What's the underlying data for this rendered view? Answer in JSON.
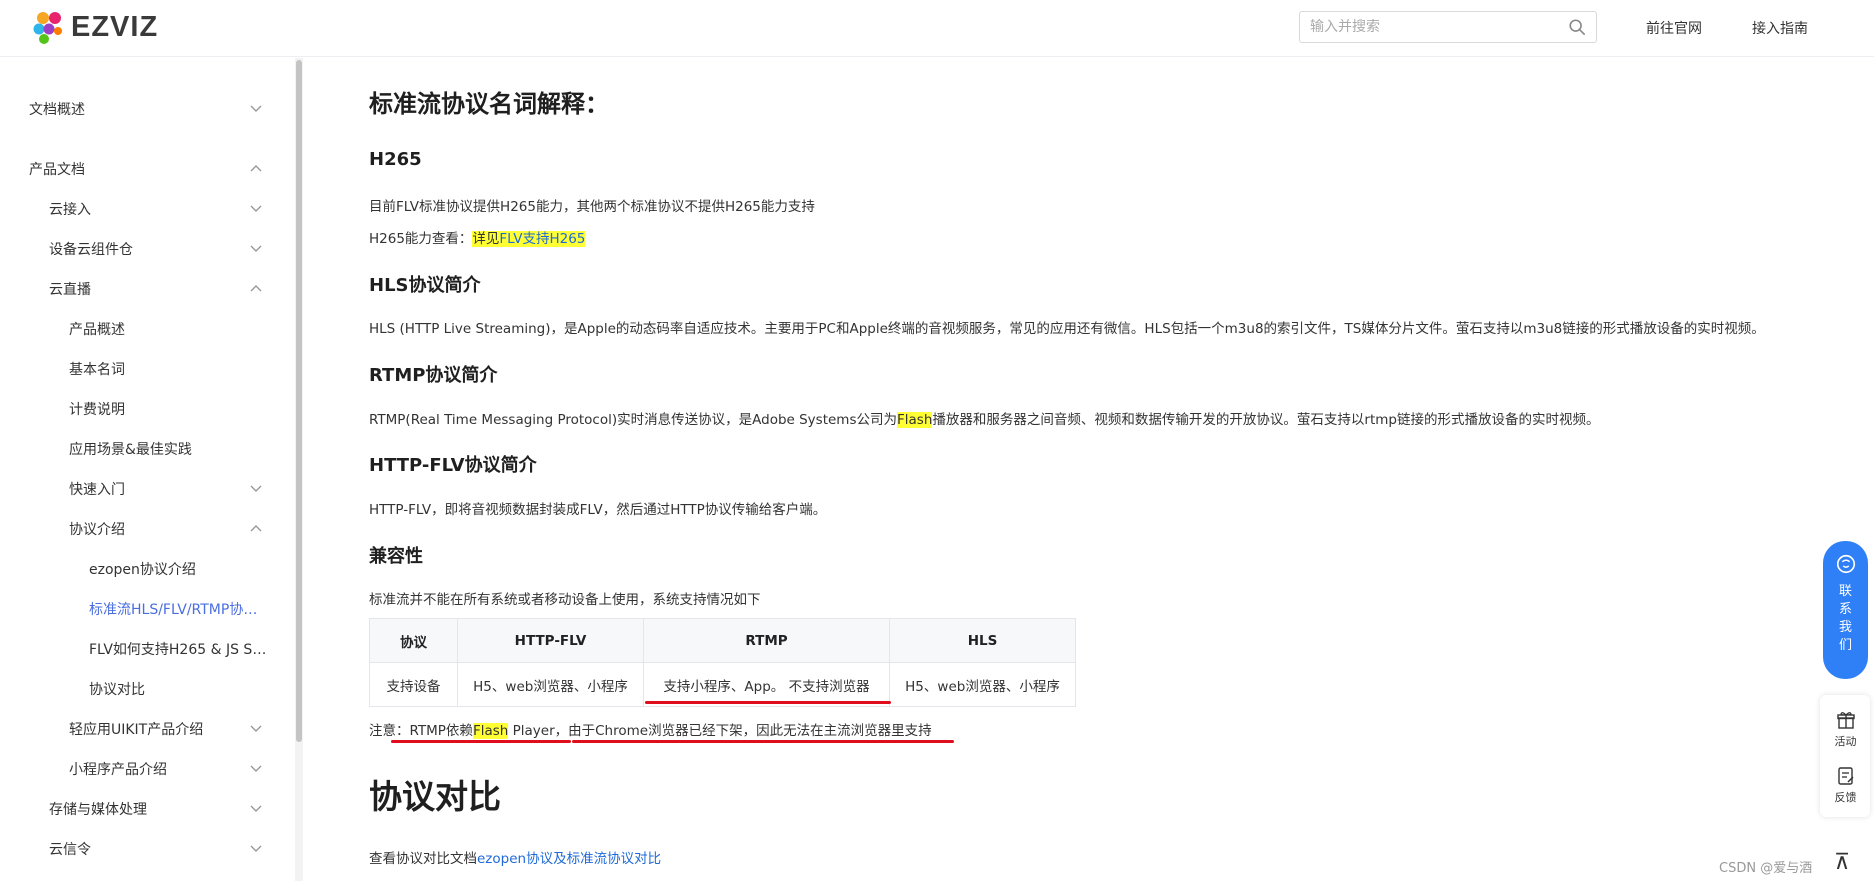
{
  "header": {
    "logo_text": "EZVIZ",
    "search_placeholder": "输入并搜索",
    "nav_official": "前往官网",
    "nav_guide": "接入指南"
  },
  "sidebar": {
    "items": [
      {
        "label": "文档概述",
        "chev": "down"
      },
      {
        "label": "产品文档",
        "chev": "up"
      },
      {
        "label": "云接入",
        "chev": "down"
      },
      {
        "label": "设备云组件仓",
        "chev": "down"
      },
      {
        "label": "云直播",
        "chev": "up"
      },
      {
        "label": "产品概述"
      },
      {
        "label": "基本名词"
      },
      {
        "label": "计费说明"
      },
      {
        "label": "应用场景&最佳实践"
      },
      {
        "label": "快速入门",
        "chev": "down"
      },
      {
        "label": "协议介绍",
        "chev": "up"
      },
      {
        "label": "ezopen协议介绍"
      },
      {
        "label": "标准流HLS/FLV/RTMP协议..."
      },
      {
        "label": "FLV如何支持H265 & JS SD..."
      },
      {
        "label": "协议对比"
      },
      {
        "label": "轻应用UIKIT产品介绍",
        "chev": "down"
      },
      {
        "label": "小程序产品介绍",
        "chev": "down"
      },
      {
        "label": "存储与媒体处理",
        "chev": "down"
      },
      {
        "label": "云信令",
        "chev": "down"
      }
    ]
  },
  "content": {
    "page_title": "标准流协议名词解释：",
    "h265": {
      "title": "H265",
      "p1": "目前FLV标准协议提供H265能力，其他两个标准协议不提供H265能力支持",
      "p2_prefix": "H265能力查看：",
      "p2_link_a": "详见",
      "p2_link_b": "FLV支持H265"
    },
    "hls": {
      "title": "HLS协议简介",
      "p": "HLS (HTTP Live Streaming)，是Apple的动态码率自适应技术。主要用于PC和Apple终端的音视频服务，常见的应用还有微信。HLS包括一个m3u8的索引文件，TS媒体分片文件。萤石支持以m3u8链接的形式播放设备的实时视频。"
    },
    "rtmp": {
      "title": "RTMP协议简介",
      "p_before": "RTMP(Real Time Messaging Protocol)实时消息传送协议，是Adobe Systems公司为",
      "p_hl": "Flash",
      "p_after": "播放器和服务器之间音频、视频和数据传输开发的开放协议。萤石支持以rtmp链接的形式播放设备的实时视频。"
    },
    "flv": {
      "title": "HTTP-FLV协议简介",
      "p": "HTTP-FLV，即将音视频数据封装成FLV，然后通过HTTP协议传输给客户端。"
    },
    "compat": {
      "title": "兼容性",
      "p": "标准流并不能在所有系统或者移动设备上使用，系统支持情况如下",
      "headers": [
        "协议",
        "HTTP-FLV",
        "RTMP",
        "HLS"
      ],
      "row": [
        "支持设备",
        "H5、web浏览器、小程序",
        "支持小程序、App。 不支持浏览器",
        "H5、web浏览器、小程序"
      ],
      "note_prefix": "注意：RTMP依赖",
      "note_hl": "Flash",
      "note_suffix": " Player，由于Chrome浏览器已经下架，因此无法在主流浏览器里支持"
    },
    "compare": {
      "title": "协议对比",
      "p_prefix": "查看协议对比文档",
      "p_link": "ezopen协议及标准流协议对比"
    }
  },
  "widgets": {
    "contact": "联系我们",
    "activity": "活动",
    "feedback": "反馈",
    "top": "⊼",
    "watermark": "CSDN @爱与酒"
  },
  "colors": {
    "accent": "#4a6ee0",
    "link": "#1f6ad8",
    "highlight": "#ffff33",
    "red_annotation": "#e00d1d",
    "contact_bg": "#2f7ff6"
  }
}
